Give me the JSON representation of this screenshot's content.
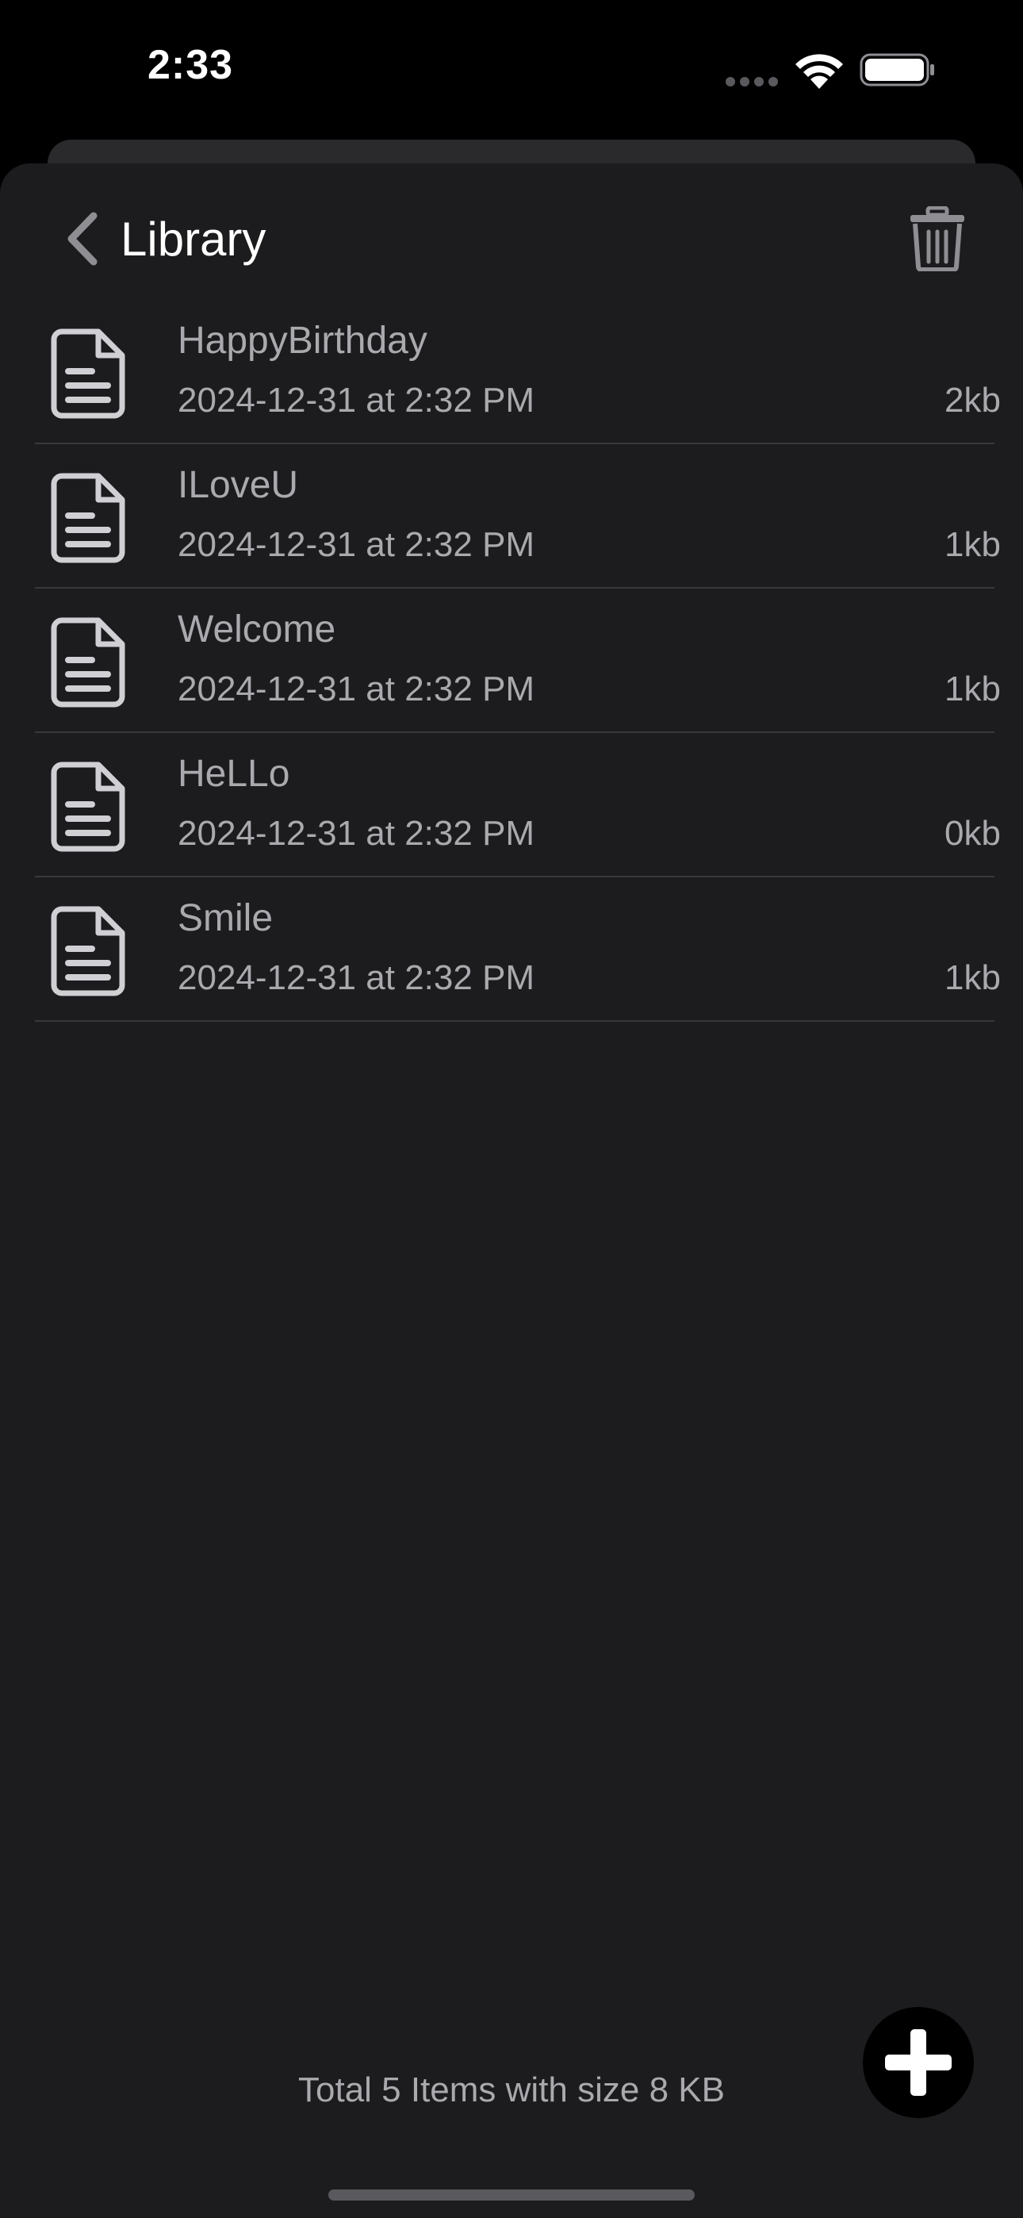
{
  "status_bar": {
    "time": "2:33",
    "icons": [
      "cellular-signal-icon",
      "wifi-icon",
      "battery-icon"
    ]
  },
  "nav": {
    "back_label": "Library",
    "back_icon": "chevron-left-icon",
    "action_icon": "trash-icon"
  },
  "files": [
    {
      "name": "HappyBirthday",
      "date": "2024-12-31 at 2:32 PM",
      "size": "2kb"
    },
    {
      "name": "ILoveU",
      "date": "2024-12-31 at 2:32 PM",
      "size": "1kb"
    },
    {
      "name": "Welcome",
      "date": "2024-12-31 at 2:32 PM",
      "size": "1kb"
    },
    {
      "name": "HeLLo",
      "date": "2024-12-31 at 2:32 PM",
      "size": "0kb"
    },
    {
      "name": "Smile",
      "date": "2024-12-31 at 2:32 PM",
      "size": "1kb"
    }
  ],
  "footer": {
    "summary": "Total 5 Items with size 8 KB",
    "add_icon": "plus-icon"
  },
  "colors": {
    "background": "#1c1c1e",
    "text_primary": "#ffffff",
    "text_secondary": "#a9a9ae",
    "separator": "#38383a",
    "icon_gray": "#8e8e93"
  }
}
